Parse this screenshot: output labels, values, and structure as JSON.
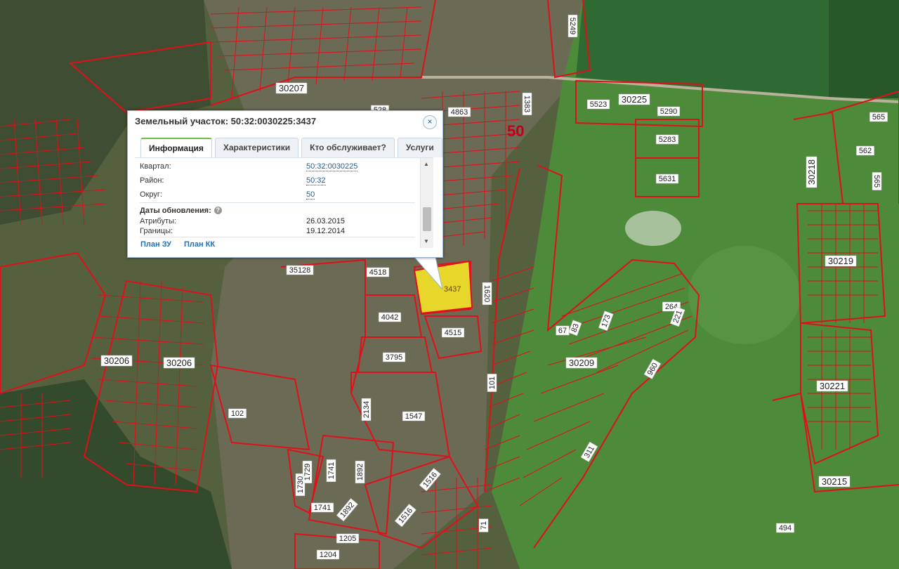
{
  "map": {
    "region_label": "50",
    "selected_parcel": "3437",
    "quarter_labels": [
      "30207",
      "30225",
      "30218",
      "30219",
      "30221",
      "30215",
      "30209",
      "30206",
      "30206"
    ],
    "parcel_labels": [
      "5249",
      "4863",
      "1383",
      "5523",
      "5290",
      "5283",
      "5631",
      "565",
      "562",
      "565",
      "528",
      "35128",
      "4518",
      "1620",
      "4042",
      "4515",
      "3795",
      "2134",
      "1547",
      "102",
      "1741",
      "1892",
      "1730",
      "1729",
      "1741",
      "1892",
      "1516",
      "1516",
      "1205",
      "1204",
      "71",
      "494",
      "311",
      "960",
      "264",
      "221",
      "67",
      "83",
      "173",
      "101"
    ],
    "colors": {
      "parcel_border": "#e0101a",
      "selected_fill": "#e6d72a",
      "field": "#4f8a3a",
      "forest": "#2f5a2a",
      "bare": "#6f6a52"
    }
  },
  "popup": {
    "title": "Земельный участок: 50:32:0030225:3437",
    "close_label": "×",
    "tabs": [
      "Информация",
      "Характеристики",
      "Кто обслуживает?",
      "Услуги"
    ],
    "fields": [
      {
        "label": "Квартал:",
        "value": "50:32:0030225"
      },
      {
        "label": "Район:",
        "value": "50:32"
      },
      {
        "label": "Округ:",
        "value": "50"
      }
    ],
    "updates_header": "Даты обновления:",
    "help_label": "?",
    "updates": [
      {
        "label": "Атрибуты:",
        "value": "26.03.2015"
      },
      {
        "label": "Границы:",
        "value": "19.12.2014"
      }
    ],
    "links": [
      "План ЗУ",
      "План КК"
    ]
  }
}
